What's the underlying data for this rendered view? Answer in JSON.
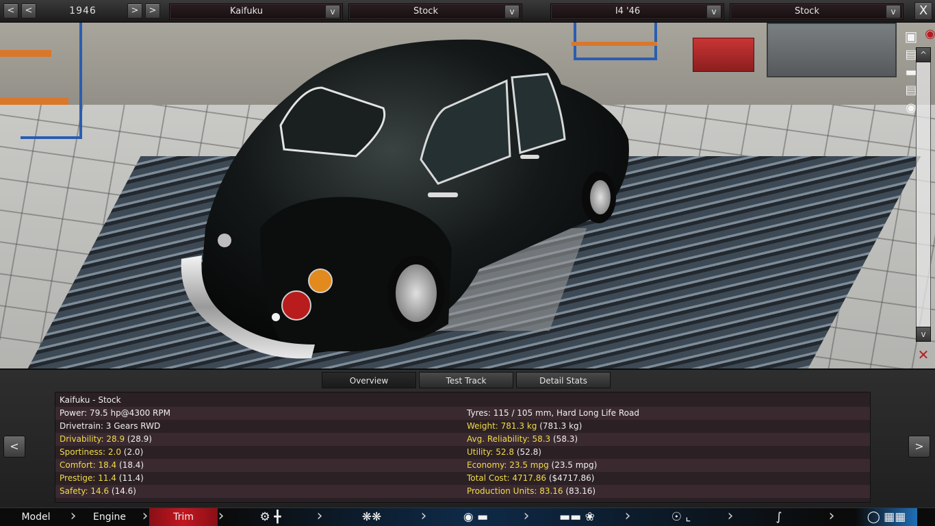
{
  "year_selector": {
    "year": "1946",
    "first": "<",
    "prev": "<",
    "next": ">",
    "last": ">"
  },
  "dropdowns": {
    "model": {
      "value": "Kaifuku",
      "arrow": "v"
    },
    "trim": {
      "value": "Stock",
      "arrow": "v"
    },
    "engine": {
      "value": "I4 '46",
      "arrow": "v"
    },
    "engine_variant": {
      "value": "Stock",
      "arrow": "v"
    }
  },
  "close": "X",
  "viewport": {
    "camera_icons": [
      "camera-icon",
      "car-front-icon",
      "car-side-icon",
      "car-rear-icon",
      "car-top-icon"
    ],
    "scroll_up": "^",
    "scroll_down": "v"
  },
  "tabs": [
    "Overview",
    "Test Track",
    "Detail Stats"
  ],
  "active_tab": "Overview",
  "side_arrows": {
    "left": "<",
    "right": ">"
  },
  "stats": {
    "title": "Kaifuku - Stock",
    "left": [
      {
        "label": "Power: 79.5 hp@4300 RPM",
        "highlight": "",
        "paren": ""
      },
      {
        "label": "Drivetrain: 3 Gears RWD",
        "highlight": "",
        "paren": ""
      },
      {
        "label": "",
        "highlight": "Drivability: 28.9",
        "paren": " (28.9)"
      },
      {
        "label": "",
        "highlight": "Sportiness: 2.0",
        "paren": " (2.0)"
      },
      {
        "label": "",
        "highlight": "Comfort: 18.4",
        "paren": " (18.4)"
      },
      {
        "label": "",
        "highlight": "Prestige: 11.4",
        "paren": " (11.4)"
      },
      {
        "label": "",
        "highlight": "Safety: 14.6",
        "paren": " (14.6)"
      }
    ],
    "right": [
      {
        "label": "Tyres: 115 / 105 mm, Hard Long Life Road",
        "highlight": "",
        "paren": ""
      },
      {
        "label": "",
        "highlight": "Weight: 781.3 kg",
        "paren": " (781.3 kg)"
      },
      {
        "label": "",
        "highlight": "Avg. Reliability: 58.3",
        "paren": " (58.3)"
      },
      {
        "label": "",
        "highlight": "Utility: 52.8",
        "paren": " (52.8)"
      },
      {
        "label": "",
        "highlight": "Economy: 23.5 mpg",
        "paren": " (23.5 mpg)"
      },
      {
        "label": "",
        "highlight": "Total Cost: 4717.86",
        "paren": " ($4717.86)"
      },
      {
        "label": "",
        "highlight": "Production Units: 83.16",
        "paren": " (83.16)"
      }
    ]
  },
  "nav": {
    "items": [
      "Model",
      "Engine",
      "Trim"
    ],
    "active": "Trim",
    "icon_groups": [
      [
        "gear-icon",
        "transmission-icon"
      ],
      [
        "wheel-icon",
        "wheel-icon"
      ],
      [
        "brake-icon",
        "chassis-icon"
      ],
      [
        "car-body-icon",
        "fan-icon"
      ],
      [
        "steering-wheel-icon",
        "seat-icon"
      ],
      [
        "suspension-icon"
      ],
      [
        "finish-flag-icon"
      ]
    ],
    "colors": {
      "active_bg": "#b0141e",
      "bar_bg": "#0b0b0b",
      "accent": "#1e6fb8"
    }
  }
}
